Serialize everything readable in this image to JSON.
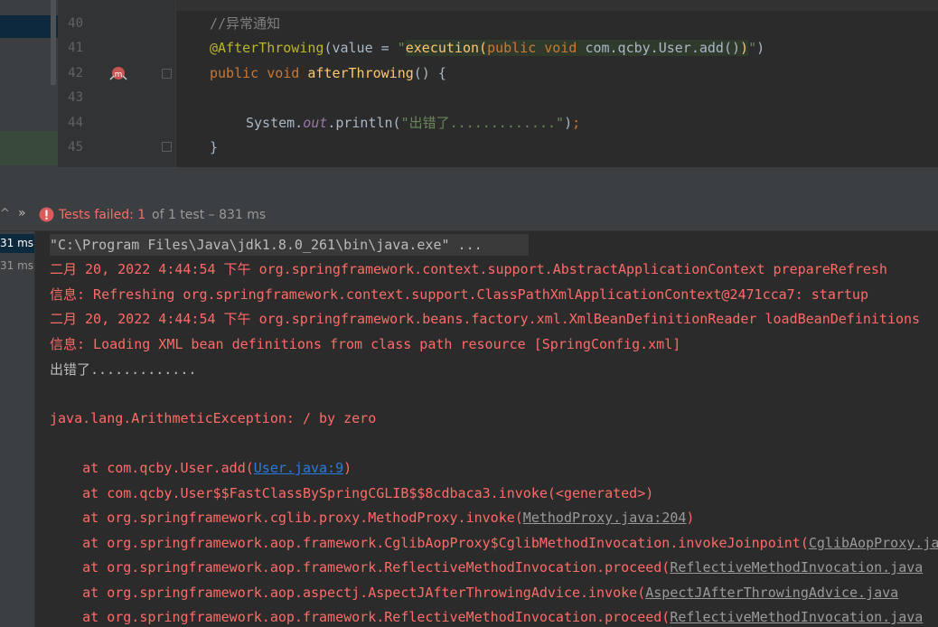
{
  "editor": {
    "line_numbers": [
      "40",
      "41",
      "42",
      "43",
      "44",
      "45"
    ],
    "lines": {
      "l40": {
        "comment": "//异常通知"
      },
      "l41": {
        "annotation": "@AfterThrowing",
        "open": "(value = ",
        "q1": "\"",
        "str_exec": "execution(",
        "str_public": "public ",
        "str_void": "void ",
        "str_rest": "com.qcby.User.add()",
        "str_close": ")",
        "q2": "\"",
        "close": ")"
      },
      "l42": {
        "kw_public": "public ",
        "kw_void": "void ",
        "method": "afterThrowing",
        "rest": "() {"
      },
      "l44": {
        "system": "System.",
        "out": "out",
        "println": ".println(",
        "str": "\"出错了.............\"",
        "close": ")",
        "semi": ";"
      },
      "l45": {
        "brace": "}"
      }
    }
  },
  "status": {
    "icon": "error-icon",
    "failed_label": "Tests failed: ",
    "failed_count": "1",
    "of_text": " of 1 test – 831 ms"
  },
  "tree": {
    "items": [
      "31 ms",
      "31 ms"
    ]
  },
  "console": {
    "cmd": "\"C:\\Program Files\\Java\\jdk1.8.0_261\\bin\\java.exe\" ...",
    "log1": "二月 20, 2022 4:44:54 下午 org.springframework.context.support.AbstractApplicationContext prepareRefresh",
    "log2": "信息: Refreshing org.springframework.context.support.ClassPathXmlApplicationContext@2471cca7: startup",
    "log3": "二月 20, 2022 4:44:54 下午 org.springframework.beans.factory.xml.XmlBeanDefinitionReader loadBeanDefinitions",
    "log4": "信息: Loading XML bean definitions from class path resource [SpringConfig.xml]",
    "out1": "出错了.............",
    "exception": "java.lang.ArithmeticException: / by zero",
    "stack": [
      {
        "prefix": "    at com.qcby.User.add(",
        "link": "User.java:9",
        "suffix": ")",
        "type": "blue"
      },
      {
        "prefix": "    at com.qcby.User$$FastClassBySpringCGLIB$$8cdbaca3.invoke(<generated>)",
        "link": "",
        "suffix": "",
        "type": "none"
      },
      {
        "prefix": "    at org.springframework.cglib.proxy.MethodProxy.invoke(",
        "link": "MethodProxy.java:204",
        "suffix": ")",
        "type": "gray"
      },
      {
        "prefix": "    at org.springframework.aop.framework.CglibAopProxy$CglibMethodInvocation.invokeJoinpoint(",
        "link": "CglibAopProxy.java",
        "suffix": "",
        "type": "gray"
      },
      {
        "prefix": "    at org.springframework.aop.framework.ReflectiveMethodInvocation.proceed(",
        "link": "ReflectiveMethodInvocation.java",
        "suffix": "",
        "type": "gray"
      },
      {
        "prefix": "    at org.springframework.aop.aspectj.AspectJAfterThrowingAdvice.invoke(",
        "link": "AspectJAfterThrowingAdvice.java",
        "suffix": "",
        "type": "gray"
      },
      {
        "prefix": "    at org.springframework.aop.framework.ReflectiveMethodInvocation.proceed(",
        "link": "ReflectiveMethodInvocation.java",
        "suffix": "",
        "type": "gray"
      }
    ]
  },
  "colors": {
    "background": "#2b2b2b",
    "error_red": "#ff6b68",
    "keyword": "#cc7832",
    "annotation": "#bbb529",
    "string": "#6a8759",
    "method": "#ffc66d",
    "link_blue": "#287bde"
  }
}
